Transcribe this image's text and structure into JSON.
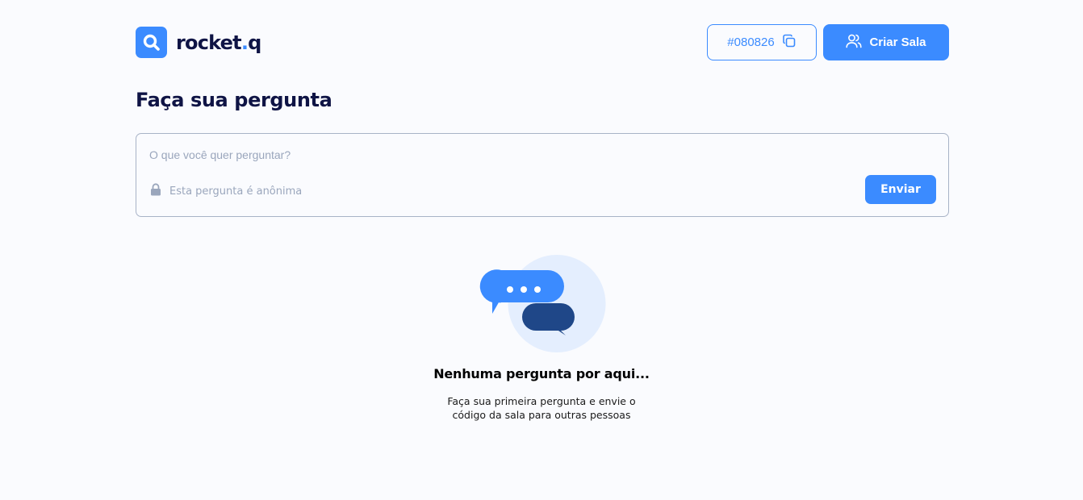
{
  "header": {
    "brand": {
      "name": "rocket",
      "dot": ".",
      "suffix": "q"
    },
    "room_code": "#080826",
    "create_room_label": "Criar Sala"
  },
  "main": {
    "title": "Faça sua pergunta",
    "question_form": {
      "placeholder": "O que você quer perguntar?",
      "value": "",
      "anonymous_label": "Esta pergunta é anônima",
      "send_label": "Enviar"
    },
    "empty_state": {
      "title": "Nenhuma pergunta por aqui...",
      "description": "Faça sua primeira pergunta e envie o código da sala para outras pessoas"
    }
  },
  "icons": {
    "logo": "magnifier-logo-icon",
    "copy": "copy-icon",
    "users": "users-icon",
    "lock": "lock-icon",
    "chat": "chat-bubbles-icon"
  },
  "colors": {
    "primary": "#3b8bff",
    "dark_text": "#0f1445",
    "background": "#fafbfe",
    "muted": "#9aa6bc",
    "border": "#a8b3c7",
    "bubble_dark": "#1f4788",
    "illustration_bg": "#e4eefe"
  }
}
